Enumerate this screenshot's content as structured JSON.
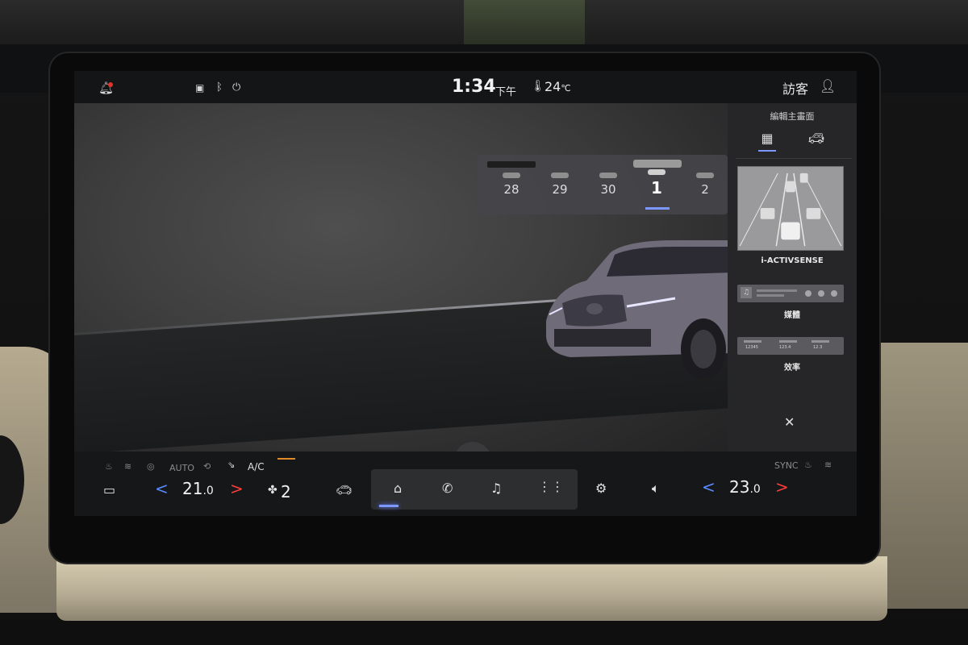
{
  "status": {
    "time": "1:34",
    "ampm": "下午",
    "temperature": "24",
    "temp_unit": "℃",
    "user": "訪客",
    "icons": [
      "bell-icon",
      "message-icon",
      "bluetooth-icon",
      "power-icon",
      "thermometer-icon",
      "user-icon"
    ]
  },
  "calendar": {
    "days": [
      "28",
      "29",
      "30",
      "1",
      "2"
    ],
    "selected": "1"
  },
  "panel": {
    "title": "編輯主畫面",
    "widgets": {
      "adas": "i-ACTIVSENSE",
      "media": "媒體",
      "efficiency": "效率",
      "efficiency_values": [
        "12345",
        "123.4",
        "12.3"
      ]
    }
  },
  "climate": {
    "auto": "AUTO",
    "ac": "A/C",
    "sync": "SYNC",
    "left_temp": "21",
    "left_temp_dec": ".0",
    "right_temp": "23",
    "right_temp_dec": ".0",
    "fan_level": "2"
  },
  "colors": {
    "accent": "#7c97ff",
    "temp_down": "#5a8bff",
    "temp_up": "#ff3b3b",
    "fan_bar": "#e08b28",
    "notification_dot": "#e0332b"
  }
}
